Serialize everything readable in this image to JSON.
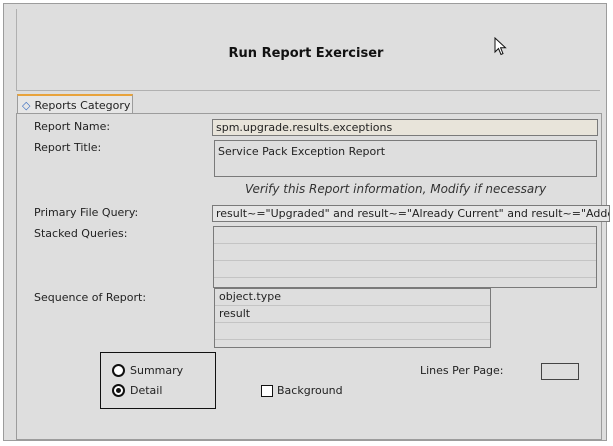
{
  "window": {
    "title": "Run Report Exerciser"
  },
  "tabs": [
    {
      "label": "Reports Category",
      "icon": "diamond-icon"
    }
  ],
  "form": {
    "report_name_label": "Report Name:",
    "report_name_value": "spm.upgrade.results.exceptions",
    "report_title_label": "Report Title:",
    "report_title_value": "Service Pack Exception Report",
    "verify_note": "Verify this Report information, Modify if necessary",
    "primary_query_label": "Primary File Query:",
    "primary_query_value": "result~=\"Upgraded\" and result~=\"Already Current\" and result~=\"Added\" and result",
    "stacked_queries_label": "Stacked Queries:",
    "sequence_label": "Sequence of Report:",
    "sequence_items": [
      "object.type",
      "result"
    ]
  },
  "options": {
    "summary_label": "Summary",
    "detail_label": "Detail",
    "selected": "Detail",
    "background_label": "Background",
    "background_checked": false,
    "lines_per_page_label": "Lines Per Page:",
    "lines_per_page_value": ""
  },
  "colors": {
    "tab_accent": "#e8a33c",
    "tab_icon": "#3c6ec0"
  }
}
